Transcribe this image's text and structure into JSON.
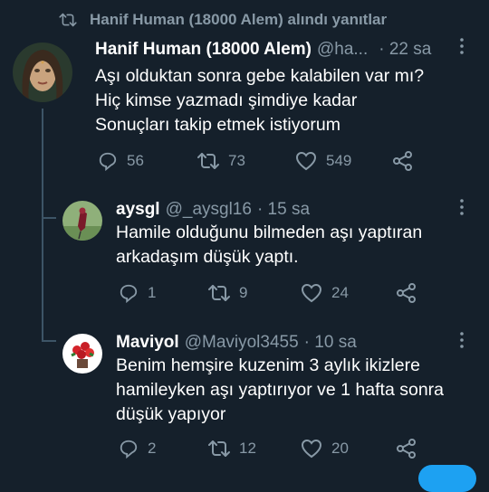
{
  "retweet_banner": {
    "text": "Hanif Human (18000 Alem) alındı yanıtlar"
  },
  "tweets": [
    {
      "name": "Hanif Human (18000 Alem)",
      "handle": "@ha...",
      "time": "· 22 sa",
      "lines": [
        "Aşı olduktan sonra gebe kalabilen var mı?",
        "Hiç kimse yazmadı şimdiye kadar",
        "Sonuçları takip etmek istiyorum"
      ],
      "replies": "56",
      "retweets": "73",
      "likes": "549"
    },
    {
      "name": "aysgl",
      "handle": "@_aysgl16",
      "time": "· 15 sa",
      "lines": [
        "Hamile olduğunu bilmeden aşı yaptıran",
        "arkadaşım düşük yaptı."
      ],
      "replies": "1",
      "retweets": "9",
      "likes": "24"
    },
    {
      "name": "Maviyol",
      "handle": "@Maviyol3455",
      "time": "· 10 sa",
      "lines": [
        "Benim hemşire kuzenim 3 aylık ikizlere",
        "hamileyken aşı yaptırıyor ve 1 hafta sonra",
        "düşük yapıyor"
      ],
      "replies": "2",
      "retweets": "12",
      "likes": "20"
    }
  ],
  "icons": [
    "retweet-icon",
    "reply-icon",
    "like-icon",
    "share-icon",
    "more-icon"
  ],
  "colors": {
    "background": "#15202b",
    "secondary_text": "#8899a6",
    "thread_line": "#3d5466",
    "accent": "#1da1f2"
  }
}
